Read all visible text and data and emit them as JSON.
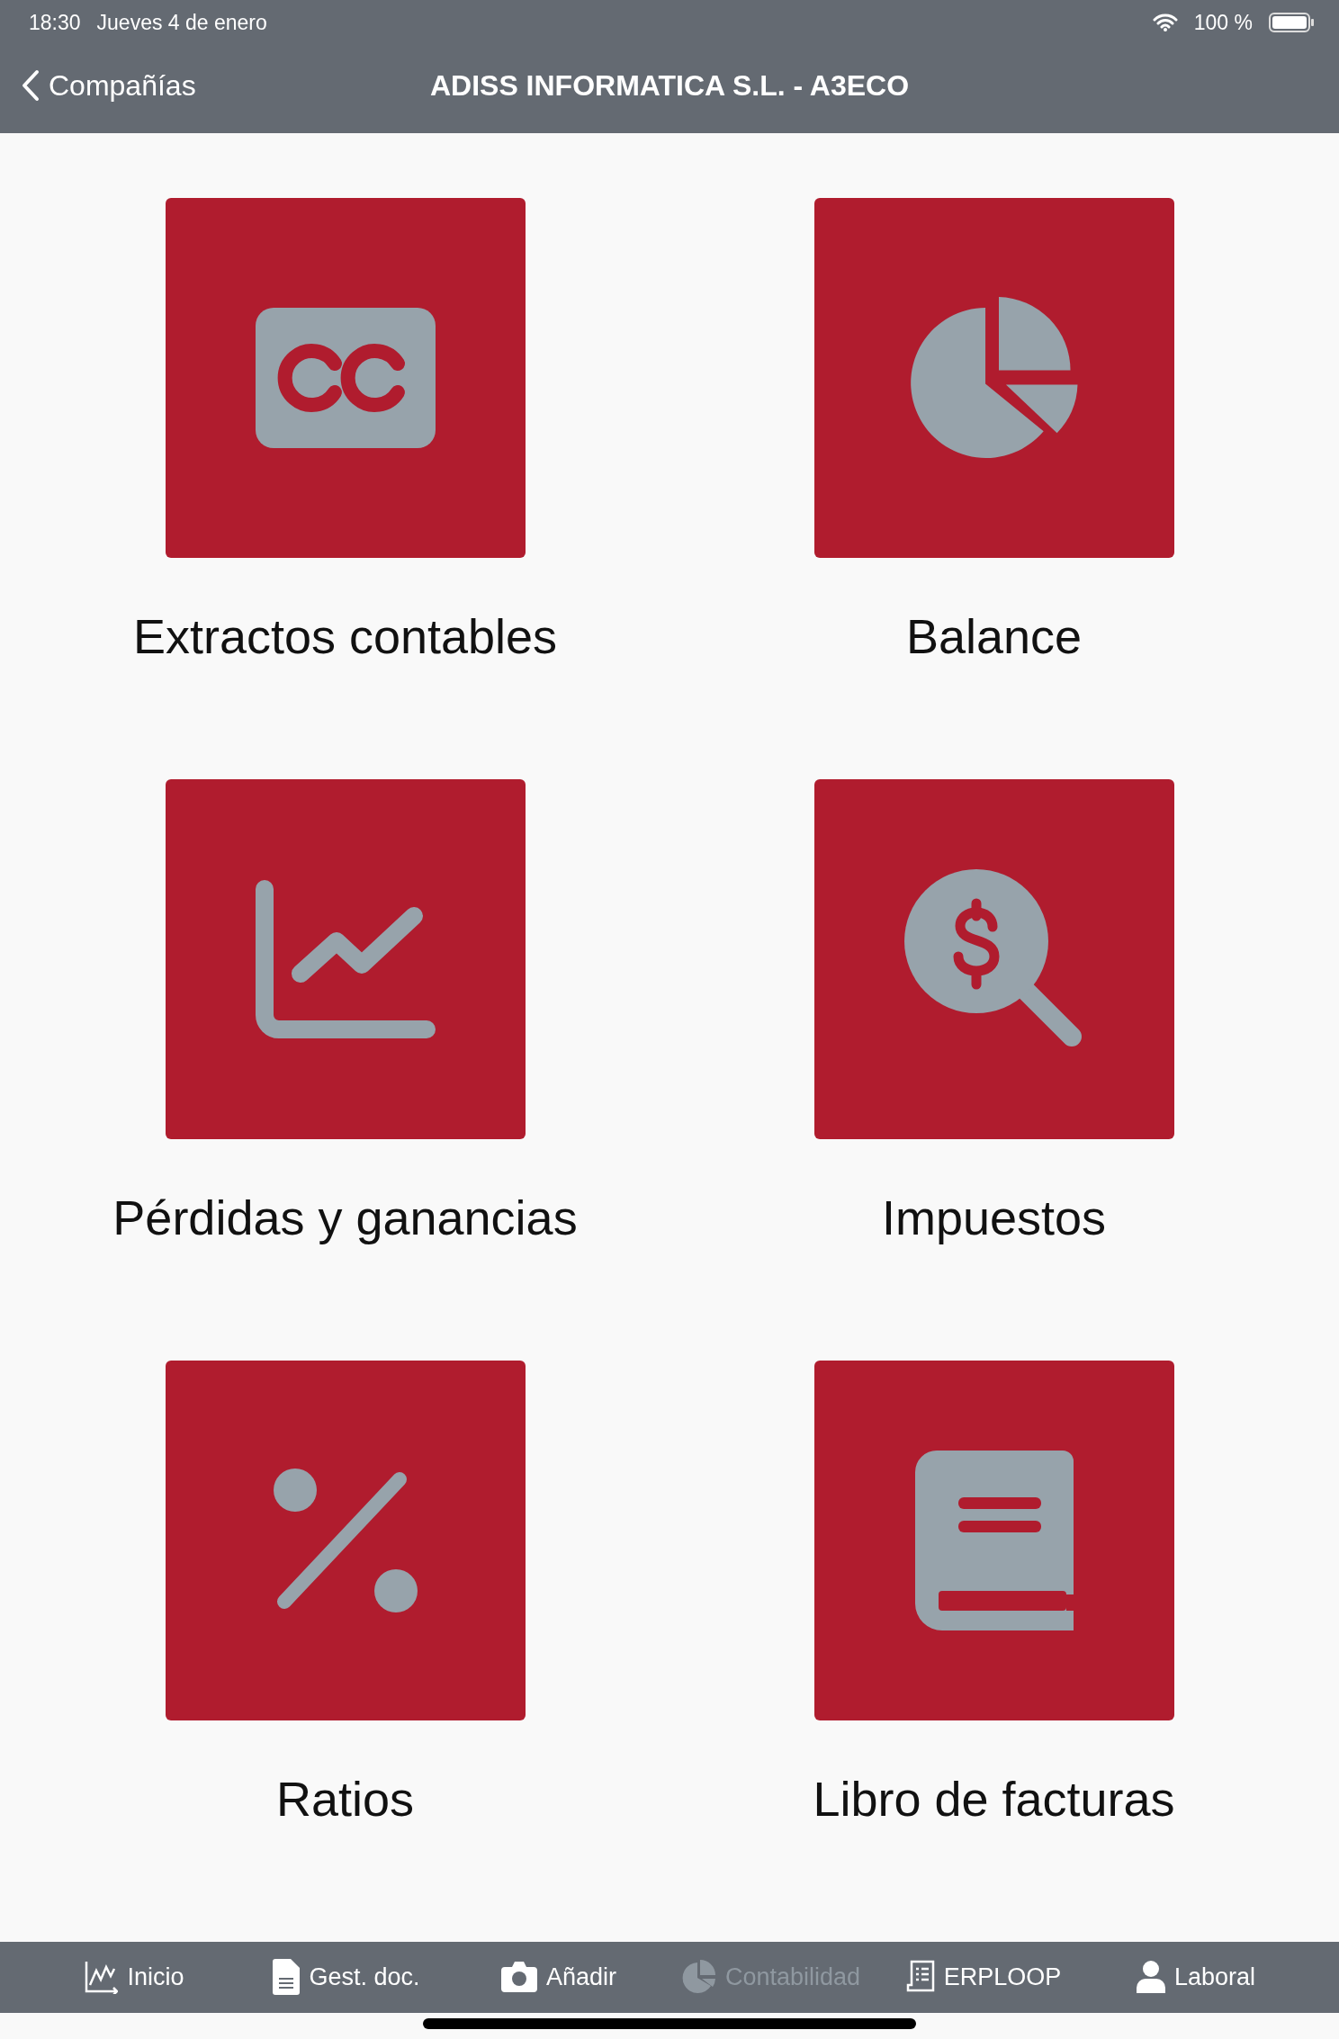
{
  "status_bar": {
    "time": "18:30",
    "date": "Jueves 4 de enero",
    "battery": "100 %"
  },
  "nav_bar": {
    "back": "Compañías",
    "title": "ADISS INFORMATICA S.L. - A3ECO"
  },
  "tiles": [
    {
      "kind": "cc",
      "label": "Extractos contables"
    },
    {
      "kind": "pie",
      "label": "Balance"
    },
    {
      "kind": "chart",
      "label": "Pérdidas y ganancias"
    },
    {
      "kind": "tax",
      "label": "Impuestos"
    },
    {
      "kind": "percent",
      "label": "Ratios"
    },
    {
      "kind": "book",
      "label": "Libro de facturas"
    }
  ],
  "tab_bar": [
    {
      "kind": "chart",
      "label": "Inicio",
      "selected": false
    },
    {
      "kind": "doc",
      "label": "Gest. doc.",
      "selected": false
    },
    {
      "kind": "camera",
      "label": "Añadir",
      "selected": false
    },
    {
      "kind": "pie",
      "label": "Contabilidad",
      "selected": true
    },
    {
      "kind": "receipt",
      "label": "ERPLOOP",
      "selected": false
    },
    {
      "kind": "person",
      "label": "Laboral",
      "selected": false
    }
  ]
}
